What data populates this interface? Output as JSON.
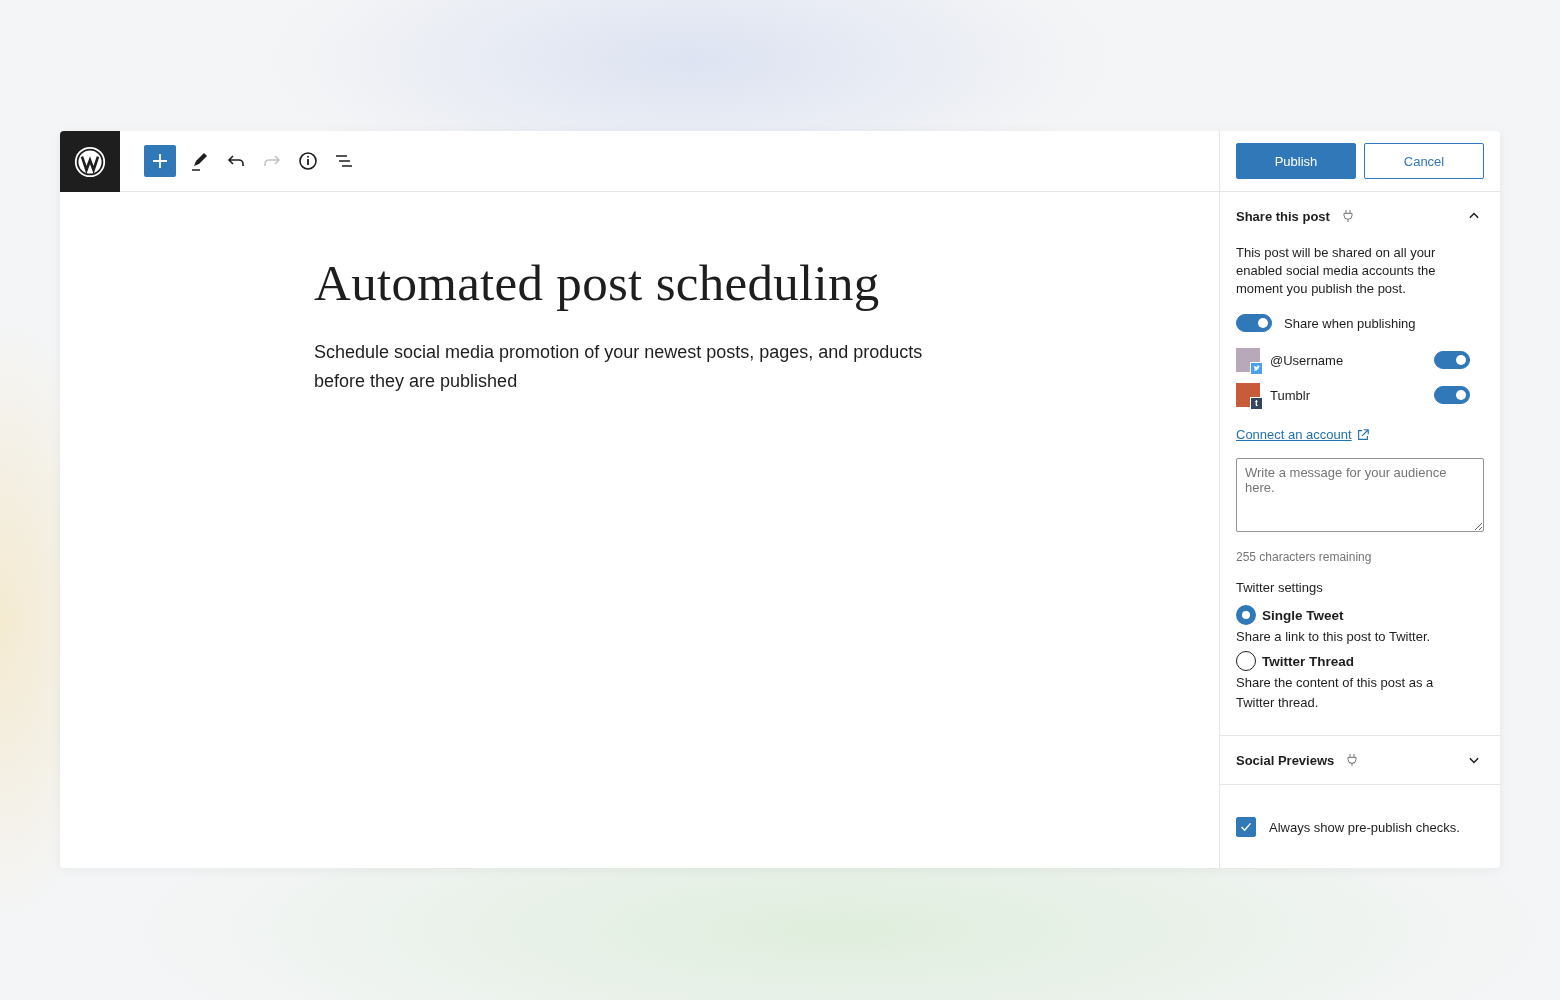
{
  "toolbar": {
    "tools": [
      {
        "kind": "add",
        "disabled": false
      },
      {
        "kind": "edit",
        "disabled": false
      },
      {
        "kind": "undo",
        "disabled": false
      },
      {
        "kind": "redo",
        "disabled": true
      },
      {
        "kind": "info",
        "disabled": false
      },
      {
        "kind": "outline",
        "disabled": false
      }
    ]
  },
  "post": {
    "title": "Automated post scheduling",
    "body": "Schedule social media promotion of your newest posts, pages, and products before they are published"
  },
  "sidebar": {
    "actions": [
      {
        "label": "Publish",
        "kind": "primary"
      },
      {
        "label": "Cancel",
        "kind": "secondary"
      }
    ],
    "share_panel": {
      "title": "Share this post",
      "expanded": true,
      "description": "This post will be shared on all your enabled social media accounts the moment you publish the post.",
      "share_toggle": {
        "label": "Share when publishing",
        "on": true
      },
      "accounts": [
        {
          "name": "@Username",
          "kind": "twitter",
          "on": true
        },
        {
          "name": "Tumblr",
          "kind": "tumblr",
          "on": true,
          "badge": "t"
        }
      ],
      "connect_link": "Connect an account",
      "message": {
        "placeholder": "Write a message for your audience here."
      },
      "remaining": "255 characters remaining",
      "twitter_settings": {
        "label": "Twitter settings",
        "options": [
          {
            "label": "Single Tweet",
            "description": "Share a link to this post to Twitter.",
            "selected": true
          },
          {
            "label": "Twitter Thread",
            "description": "Share the content of this post as a Twitter thread.",
            "selected": false
          }
        ]
      }
    },
    "previews_panel": {
      "title": "Social Previews",
      "expanded": false
    },
    "prepublish": {
      "label": "Always show pre-publish checks.",
      "checked": true
    }
  }
}
